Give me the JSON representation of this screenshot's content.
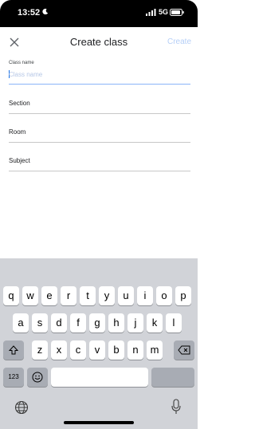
{
  "status_bar": {
    "time": "13:52",
    "network": "5G"
  },
  "header": {
    "title": "Create class",
    "create_label": "Create"
  },
  "form": {
    "class_name": {
      "label": "Class name",
      "placeholder": "Class name",
      "value": ""
    },
    "section": {
      "label": "Section"
    },
    "room": {
      "label": "Room"
    },
    "subject": {
      "label": "Subject"
    }
  },
  "keyboard": {
    "row1": [
      "q",
      "w",
      "e",
      "r",
      "t",
      "y",
      "u",
      "i",
      "o",
      "p"
    ],
    "row2": [
      "a",
      "s",
      "d",
      "f",
      "g",
      "h",
      "j",
      "k",
      "l"
    ],
    "row3": [
      "z",
      "x",
      "c",
      "v",
      "b",
      "n",
      "m"
    ],
    "numbers_label": "123"
  },
  "icons": {
    "moon": "moon-icon",
    "signal": "signal-icon",
    "battery": "battery-icon",
    "close": "close-icon",
    "shift": "shift-icon",
    "backspace": "backspace-icon",
    "emoji": "emoji-icon",
    "globe": "globe-icon",
    "mic": "microphone-icon"
  },
  "colors": {
    "accent": "#1a73e8",
    "create_disabled": "#b6cff7",
    "keyboard_bg": "#d1d3d8"
  }
}
